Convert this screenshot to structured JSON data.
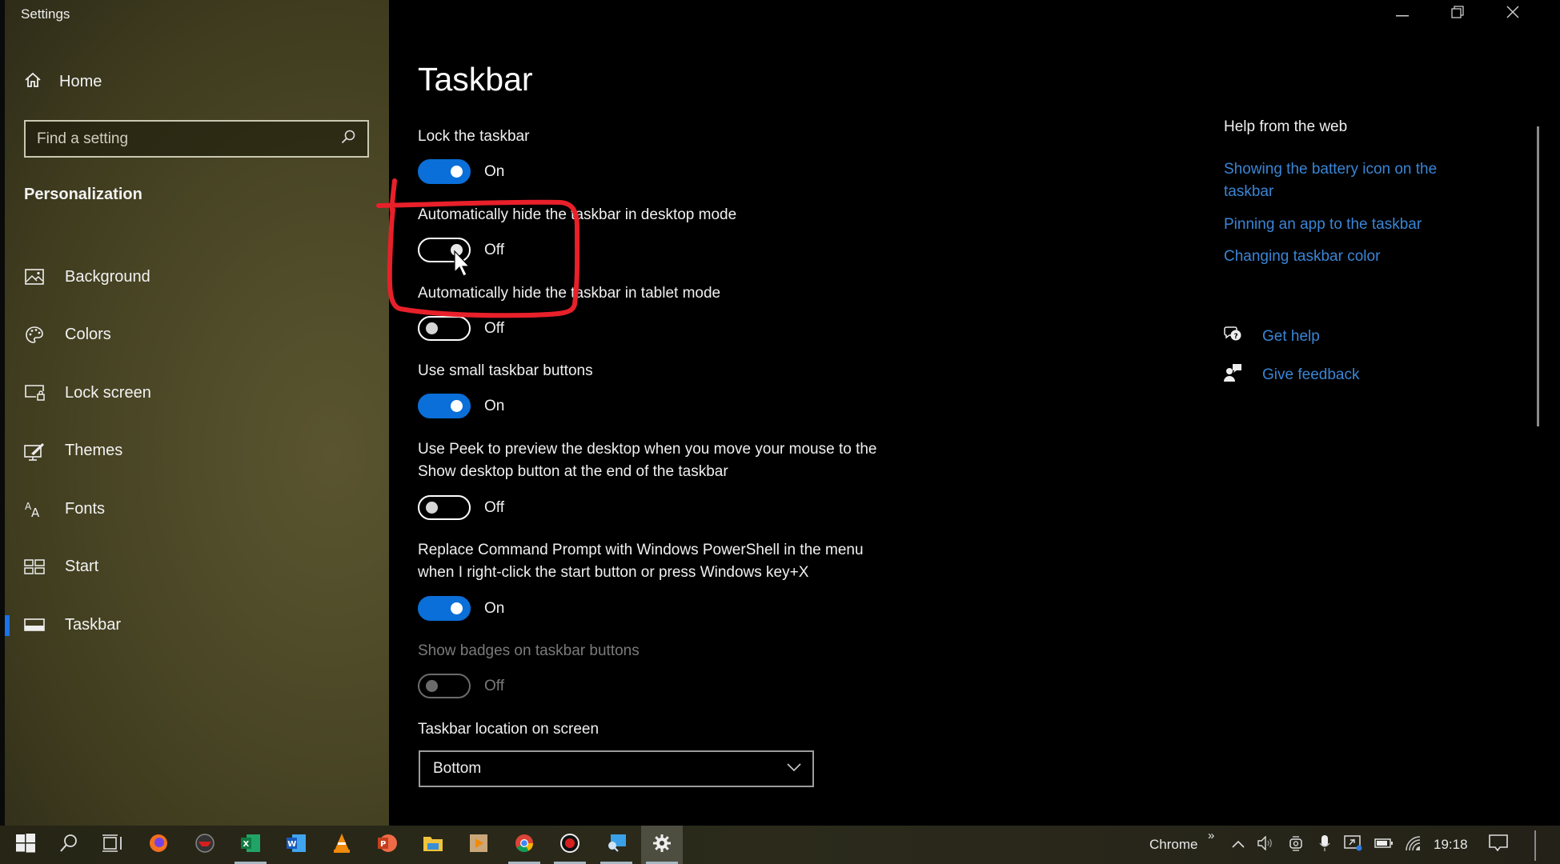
{
  "window": {
    "app_title": "Settings",
    "controls": {
      "minimize": "minimize-icon",
      "restore": "restore-icon",
      "close": "close-icon"
    }
  },
  "sidebar": {
    "home_label": "Home",
    "search": {
      "placeholder": "Find a setting",
      "value": ""
    },
    "section_title": "Personalization",
    "items": [
      {
        "label": "Background",
        "icon": "picture-icon",
        "active": false
      },
      {
        "label": "Colors",
        "icon": "palette-icon",
        "active": false
      },
      {
        "label": "Lock screen",
        "icon": "lock-screen-icon",
        "active": false
      },
      {
        "label": "Themes",
        "icon": "themes-icon",
        "active": false
      },
      {
        "label": "Fonts",
        "icon": "fonts-icon",
        "active": false
      },
      {
        "label": "Start",
        "icon": "start-tiles-icon",
        "active": false
      },
      {
        "label": "Taskbar",
        "icon": "taskbar-icon",
        "active": true
      }
    ]
  },
  "main": {
    "title": "Taskbar",
    "settings": [
      {
        "label": "Lock the taskbar",
        "state": "On"
      },
      {
        "label": "Automatically hide the taskbar in desktop mode",
        "state": "Off"
      },
      {
        "label": "Automatically hide the taskbar in tablet mode",
        "state": "Off"
      },
      {
        "label": "Use small taskbar buttons",
        "state": "On"
      },
      {
        "label": "Use Peek to preview the desktop when you move your mouse to the Show desktop button at the end of the taskbar",
        "label_lines": [
          "Use Peek to preview the desktop when you move your mouse to the",
          "Show desktop button at the end of the taskbar"
        ],
        "state": "Off"
      },
      {
        "label": "Replace Command Prompt with Windows PowerShell in the menu when I right-click the start button or press Windows key+X",
        "label_lines": [
          "Replace Command Prompt with Windows PowerShell in the menu",
          "when I right-click the start button or press Windows key+X"
        ],
        "state": "On"
      },
      {
        "label": "Show badges on taskbar buttons",
        "state": "Off",
        "disabled": true
      }
    ],
    "location": {
      "label": "Taskbar location on screen",
      "selected": "Bottom"
    }
  },
  "help": {
    "title": "Help from the web",
    "links": [
      {
        "lines": [
          "Showing the battery icon on the",
          "taskbar"
        ]
      },
      {
        "lines": [
          "Pinning an app to the taskbar"
        ]
      },
      {
        "lines": [
          "Changing taskbar color"
        ]
      }
    ],
    "actions": [
      {
        "label": "Get help",
        "icon": "get-help-icon"
      },
      {
        "label": "Give feedback",
        "icon": "give-feedback-icon"
      }
    ]
  },
  "taskbar": {
    "pinned": [
      "start-windows-icon",
      "search-icon",
      "task-view-icon",
      "firefox-icon",
      "app-red-icon",
      "excel-icon",
      "word-icon",
      "vlc-icon",
      "powerpoint-icon",
      "file-explorer-icon",
      "media-player-icon",
      "chrome-icon",
      "recorder-icon",
      "remote-desktop-icon",
      "settings-gear-icon"
    ],
    "toolbar_label": "Chrome",
    "toolbar_more": "»",
    "clock": "19:18"
  },
  "colors": {
    "accent": "#0a6fd8",
    "link": "#3a85d6",
    "annotation": "#e8202a"
  }
}
